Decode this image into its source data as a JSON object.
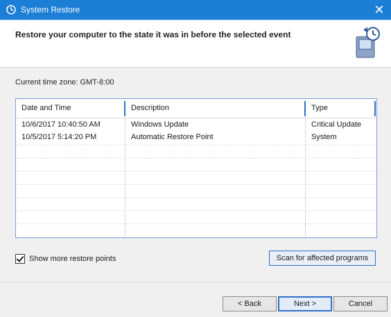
{
  "window": {
    "title": "System Restore",
    "close_glyph": "✕"
  },
  "header": {
    "heading": "Restore your computer to the state it was in before the selected event"
  },
  "timezone_label": "Current time zone: GMT-8:00",
  "table": {
    "columns": [
      "Date and Time",
      "Description",
      "Type"
    ],
    "rows": [
      [
        "10/6/2017 10:40:50 AM",
        "Windows Update",
        "Critical Update"
      ],
      [
        "10/5/2017 5:14:20 PM",
        "Automatic Restore Point",
        "System"
      ]
    ]
  },
  "options": {
    "show_more_label": "Show more restore points",
    "scan_button_label": "Scan for affected programs"
  },
  "footer": {
    "back_label": "< Back",
    "next_label": "Next >",
    "cancel_label": "Cancel"
  },
  "colors": {
    "titlebar": "#1c7fd6",
    "accent": "#2f6fc9"
  }
}
